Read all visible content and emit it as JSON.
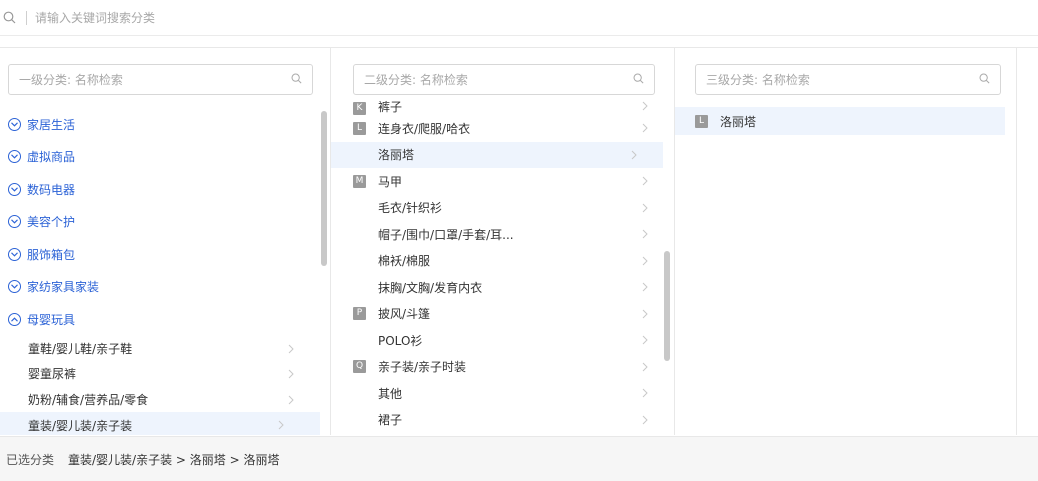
{
  "search": {
    "placeholder": "请输入关键词搜索分类"
  },
  "panel1": {
    "placeholder": "一级分类: 名称检索",
    "groups": [
      {
        "label": "家居生活"
      },
      {
        "label": "虚拟商品"
      },
      {
        "label": "数码电器"
      },
      {
        "label": "美容个护"
      },
      {
        "label": "服饰箱包"
      },
      {
        "label": "家纺家具家装"
      },
      {
        "label": "母婴玩具"
      }
    ],
    "children": [
      {
        "label": "童鞋/婴儿鞋/亲子鞋"
      },
      {
        "label": "婴童尿裤"
      },
      {
        "label": "奶粉/辅食/营养品/零食"
      },
      {
        "label": "童装/婴儿装/亲子装"
      }
    ]
  },
  "panel2": {
    "placeholder": "二级分类: 名称检索",
    "items": [
      {
        "letter": "K",
        "label": "裤子"
      },
      {
        "letter": "L",
        "label": "连身衣/爬服/哈衣"
      },
      {
        "letter": "",
        "label": "洛丽塔"
      },
      {
        "letter": "M",
        "label": "马甲"
      },
      {
        "letter": "",
        "label": "毛衣/针织衫"
      },
      {
        "letter": "",
        "label": "帽子/围巾/口罩/手套/耳..."
      },
      {
        "letter": "",
        "label": "棉袄/棉服"
      },
      {
        "letter": "",
        "label": "抹胸/文胸/发育内衣"
      },
      {
        "letter": "P",
        "label": "披风/斗篷"
      },
      {
        "letter": "",
        "label": "POLO衫"
      },
      {
        "letter": "Q",
        "label": "亲子装/亲子时装"
      },
      {
        "letter": "",
        "label": "其他"
      },
      {
        "letter": "",
        "label": "裙子"
      }
    ]
  },
  "panel3": {
    "placeholder": "三级分类: 名称检索",
    "items": [
      {
        "letter": "L",
        "label": "洛丽塔"
      }
    ]
  },
  "footer": {
    "label": "已选分类",
    "path": "童装/婴儿装/亲子装 > 洛丽塔 > 洛丽塔"
  },
  "colors": {
    "accent": "#2b62d6",
    "highlight": "#eef4fd",
    "letter_badge": "#9a9a9a"
  }
}
